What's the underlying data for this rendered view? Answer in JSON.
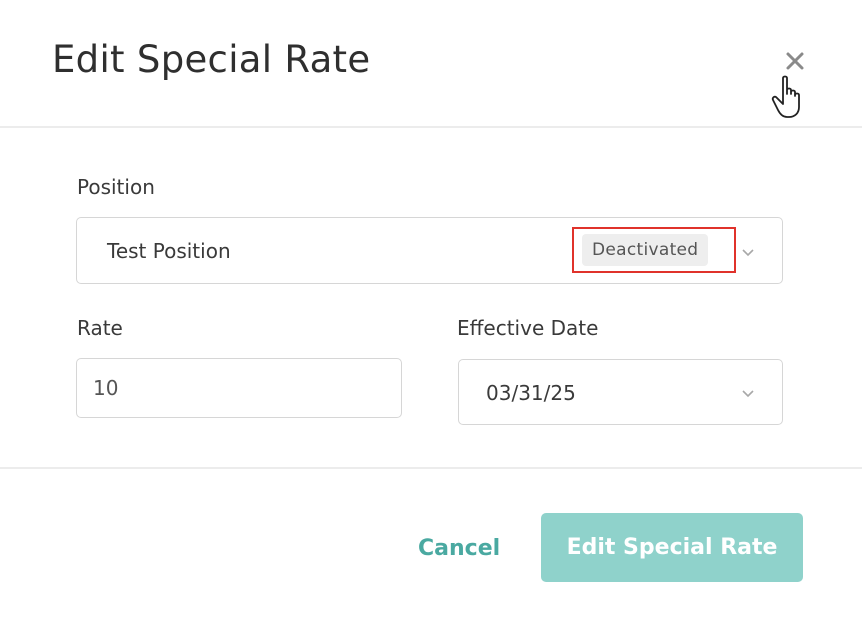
{
  "dialog": {
    "title": "Edit Special Rate"
  },
  "form": {
    "position": {
      "label": "Position",
      "value": "Test Position",
      "status_badge": "Deactivated"
    },
    "rate": {
      "label": "Rate",
      "value": "10"
    },
    "effective_date": {
      "label": "Effective Date",
      "value": "03/31/25"
    }
  },
  "footer": {
    "cancel_label": "Cancel",
    "submit_label": "Edit Special Rate"
  },
  "icons": {
    "close": "close-icon",
    "chevron": "chevron-down-icon",
    "cursor": "hand-pointer-cursor"
  },
  "colors": {
    "accent": "#4aa9a1",
    "submit_disabled_bg": "#8fd2cb",
    "highlight": "#e0322b"
  }
}
